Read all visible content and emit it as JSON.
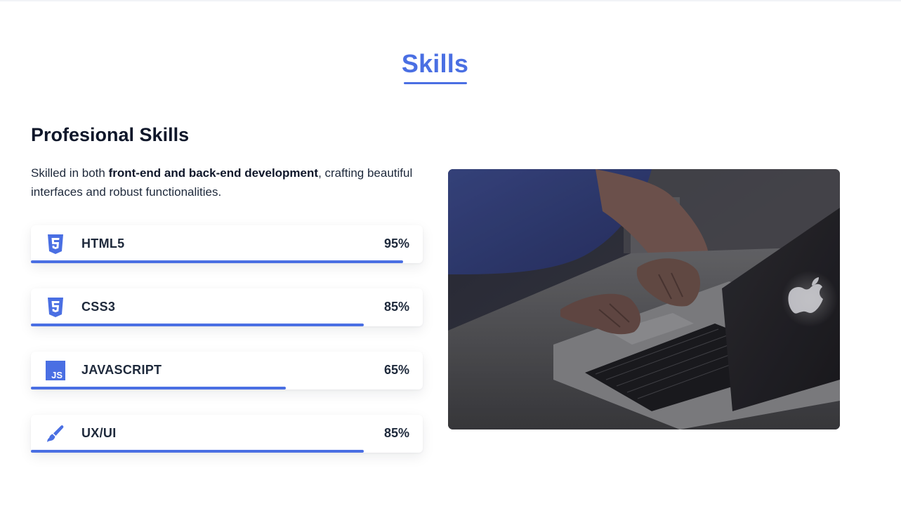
{
  "section": {
    "title": "Skills"
  },
  "professional": {
    "heading": "Profesional Skills",
    "intro_before": "Skilled in both ",
    "intro_bold": "front-end and back-end development",
    "intro_after": ", crafting beautiful interfaces and robust functionalities."
  },
  "skills": [
    {
      "name": "HTML5",
      "percent_label": "95%",
      "level": 0.95,
      "icon": "html5-icon"
    },
    {
      "name": "CSS3",
      "percent_label": "85%",
      "level": 0.85,
      "icon": "css3-icon"
    },
    {
      "name": "JAVASCRIPT",
      "percent_label": "65%",
      "level": 0.65,
      "icon": "javascript-icon"
    },
    {
      "name": "UX/UI",
      "percent_label": "85%",
      "level": 0.85,
      "icon": "paintbrush-icon"
    }
  ],
  "photo": {
    "subject": "laptop-typing-photo"
  },
  "colors": {
    "accent": "#4a6fe3",
    "heading": "#0f172a",
    "text": "#1e293b"
  }
}
